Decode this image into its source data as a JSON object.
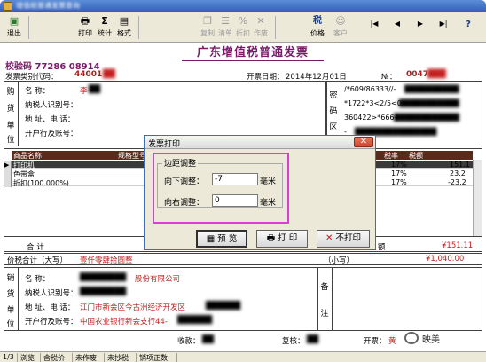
{
  "window": {
    "title": "增值税普通发票查询"
  },
  "toolbar": {
    "buttons": [
      {
        "label": "退出",
        "icon": "exit-icon"
      },
      {
        "label": "打印",
        "icon": "print-icon"
      },
      {
        "label": "统计",
        "icon": "sigma-icon"
      },
      {
        "label": "格式",
        "icon": "format-icon"
      },
      {
        "label": "复制",
        "icon": "copy-icon"
      },
      {
        "label": "清单",
        "icon": "list-icon"
      },
      {
        "label": "折扣",
        "icon": "discount-icon"
      },
      {
        "label": "作废",
        "icon": "void-icon"
      },
      {
        "label": "价格",
        "icon": "tax-icon",
        "badge": "税"
      },
      {
        "label": "客户",
        "icon": "customer-icon"
      }
    ],
    "nav": {
      "first": "|◀",
      "prev": "◀",
      "next": "▶",
      "last": "▶|",
      "help": "?"
    }
  },
  "invoice": {
    "title": "广东增值税普通发票",
    "check_code_label": "校验码",
    "check_code": "77286 08914",
    "type_code_label": "发票类别代码：",
    "type_code": "44001",
    "date_label": "开票日期：",
    "date": "2014年12月01日",
    "number_label": "№：",
    "number": "0047",
    "buyer": {
      "side_label": [
        "购",
        "货",
        "单",
        "位"
      ],
      "name_label": "名 称：",
      "name": "李",
      "tax_id_label": "纳税人识别号：",
      "address_label": "地 址、电 话：",
      "bank_label": "开户行及账号："
    },
    "cipher": {
      "side_label": [
        "密",
        "码",
        "区"
      ],
      "lines": [
        "/*609/86333//-",
        "*1722*3<2/5<0",
        "360422>*666+",
        "-"
      ]
    },
    "items": {
      "headers": [
        "商品名称",
        "规格型号",
        "税率",
        "税额"
      ],
      "rows": [
        {
          "name": "打印机",
          "rate": "17%",
          "tax": "151.1"
        },
        {
          "name": "色带盒",
          "rate": "17%",
          "tax": "23.2"
        },
        {
          "name": "折扣(100.000%)",
          "rate": "17%",
          "tax": "-23.2"
        }
      ]
    },
    "total_label": "合 计",
    "total_tax": "¥151.11",
    "total_amount_fragment": "额",
    "grand_label": "价税合计（大写）",
    "grand_words": "壹仟零肆拾圆整",
    "grand_small_label": "（小写）",
    "grand_amount": "¥1,040.00",
    "seller": {
      "side_label": [
        "销",
        "货",
        "单",
        "位"
      ],
      "name_label": "名 称：",
      "name": "股份有限公司",
      "tax_id_label": "纳税人识别号：",
      "address_label": "地 址、电 话：",
      "address": "江门市新会区今古洲经济开发区",
      "bank_label": "开户行及账号：",
      "bank": "中国农业银行新会支行44-"
    },
    "remark_label": [
      "备",
      "注"
    ],
    "payee_label": "收款：",
    "reviewer_label": "复核：",
    "issuer_label": "开票：",
    "issuer": "黄"
  },
  "dialog": {
    "title": "发票打印",
    "group_label": "边距调整",
    "down_label": "向下调整：",
    "down_value": "-7",
    "right_label": "向右调整：",
    "right_value": "0",
    "unit": "毫米",
    "preview_label": "预 览",
    "print_label": "打 印",
    "noprint_label": "不打印"
  },
  "statusbar": {
    "items": [
      "1/3",
      "浏览",
      "含税价",
      "未作废",
      "未抄税",
      "销项正数"
    ]
  },
  "watermark": {
    "text": "映美"
  }
}
